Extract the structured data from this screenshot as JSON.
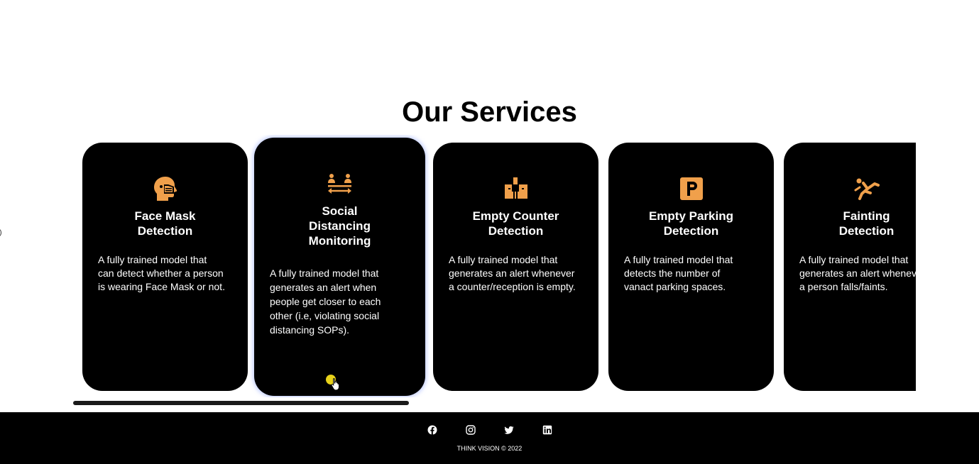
{
  "section": {
    "title": "Our Services"
  },
  "cards": [
    {
      "icon": "head-mask-icon",
      "title": "Face Mask\nDetection",
      "description": "A fully trained model that\ncan detect whether a person\nis wearing Face Mask or not."
    },
    {
      "icon": "people-distance-icon",
      "title": "Social\nDistancing\nMonitoring",
      "description": "A fully trained model that\ngenerates an alert when\npeople get closer to each\nother (i.e, violating social\ndistancing SOPs)."
    },
    {
      "icon": "reception-counter-icon",
      "title": "Empty Counter\nDetection",
      "description": "A fully trained model that\ngenerates an alert whenever\na counter/reception is empty."
    },
    {
      "icon": "parking-icon",
      "title": "Empty Parking\nDetection",
      "description": "A fully trained model that\ndetects the number of\nvanact parking spaces."
    },
    {
      "icon": "person-falling-icon",
      "title": "Fainting\nDetection",
      "description": "A fully trained model that\ngenerates an alert whenever\na person falls/faints."
    }
  ],
  "footer": {
    "social": [
      "facebook-icon",
      "instagram-icon",
      "twitter-icon",
      "linkedin-icon"
    ],
    "copyright": "THINK VISION © 2022"
  },
  "colors": {
    "card_bg": "#000000",
    "icon_accent": "#f0a04b",
    "footer_bg": "#000000",
    "cursor_highlight": "#e8d21a"
  }
}
